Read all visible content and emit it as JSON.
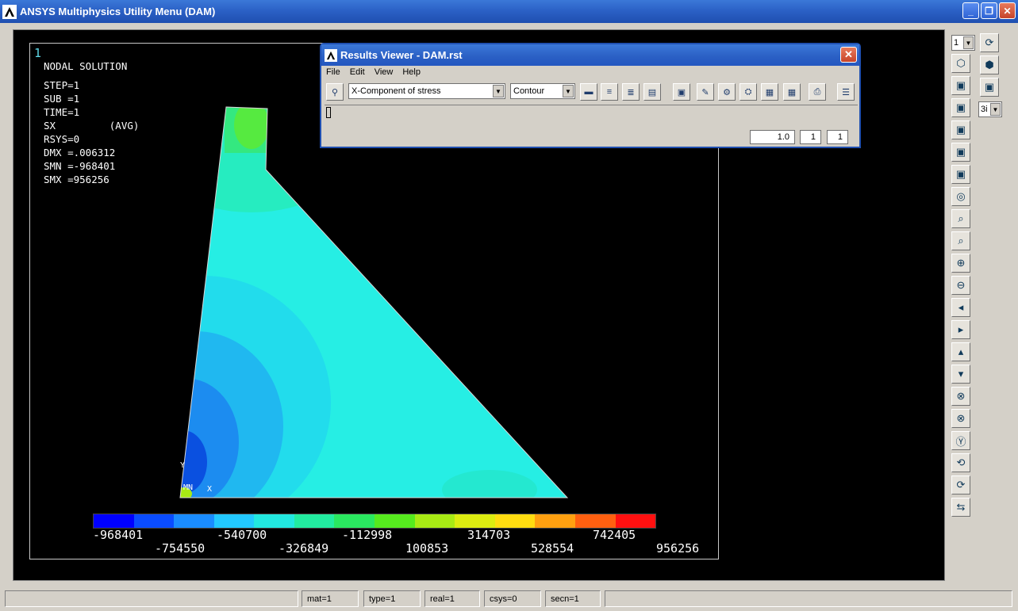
{
  "window": {
    "title": "ANSYS Multiphysics Utility Menu (DAM)",
    "buttons": [
      "minimize-icon",
      "restore-icon",
      "close-icon"
    ]
  },
  "graphics": {
    "window_number": "1",
    "info": {
      "line1": "NODAL SOLUTION",
      "line2": "STEP=1",
      "line3": "SUB =1",
      "line4": "TIME=1",
      "line5": "SX         (AVG)",
      "line6": "RSYS=0",
      "line7": "DMX =.006312",
      "line8": "SMN =-968401",
      "line9": "SMX =956256"
    },
    "axis_labels": {
      "y": "Y",
      "mn": "MN",
      "x": "X"
    },
    "legend": {
      "colors": [
        "#0000ff",
        "#0a4cff",
        "#1a8cff",
        "#22c8ff",
        "#22e8e0",
        "#22eca0",
        "#2ae860",
        "#56ea1e",
        "#a8ea14",
        "#dcec10",
        "#ffdc10",
        "#ffa010",
        "#ff6010",
        "#ff1010"
      ],
      "labels_top": [
        "-968401",
        "-540700",
        "-112998",
        "314703",
        "742405"
      ],
      "labels_bottom": [
        "-754550",
        "-326849",
        "100853",
        "528554",
        "956256"
      ]
    }
  },
  "side_toolbar": {
    "window_select": "1",
    "view_select": "3i",
    "icons": [
      "fit-icon",
      "iso-view-icon",
      "front-view-icon",
      "back-view-icon",
      "top-view-icon",
      "bottom-view-icon",
      "left-view-icon",
      "right-view-icon",
      "oblique-view-icon",
      "zoom-icon",
      "box-zoom-icon",
      "win-zoom-icon",
      "zoom-in-icon",
      "zoom-out-icon",
      "pan-left-icon",
      "pan-right-icon",
      "pan-up-icon",
      "pan-down-icon",
      "rotate-x-icon",
      "rotate-y-icon",
      "rotate-z-icon",
      "dynamic-rotate-icon",
      "rotate-z-ccw-icon",
      "reset-icon"
    ]
  },
  "status_bar": {
    "mat": "mat=1",
    "type": "type=1",
    "real": "real=1",
    "csys": "csys=0",
    "secn": "secn=1"
  },
  "results_viewer": {
    "title": "Results Viewer -  DAM.rst",
    "menu": [
      "File",
      "Edit",
      "View",
      "Help"
    ],
    "result_item": "X-Component of stress",
    "plot_type": "Contour",
    "field_scale": "1.0",
    "field_step": "1",
    "field_sub": "1",
    "toolbar_icons": [
      "plot-results-icon",
      "list-results-icon",
      "query-results-icon",
      "listing-icon",
      "image-capture-icon",
      "animate-icon",
      "step-icon",
      "view-icon",
      "grid-icon",
      "table-icon",
      "print-icon",
      "options-icon"
    ]
  }
}
